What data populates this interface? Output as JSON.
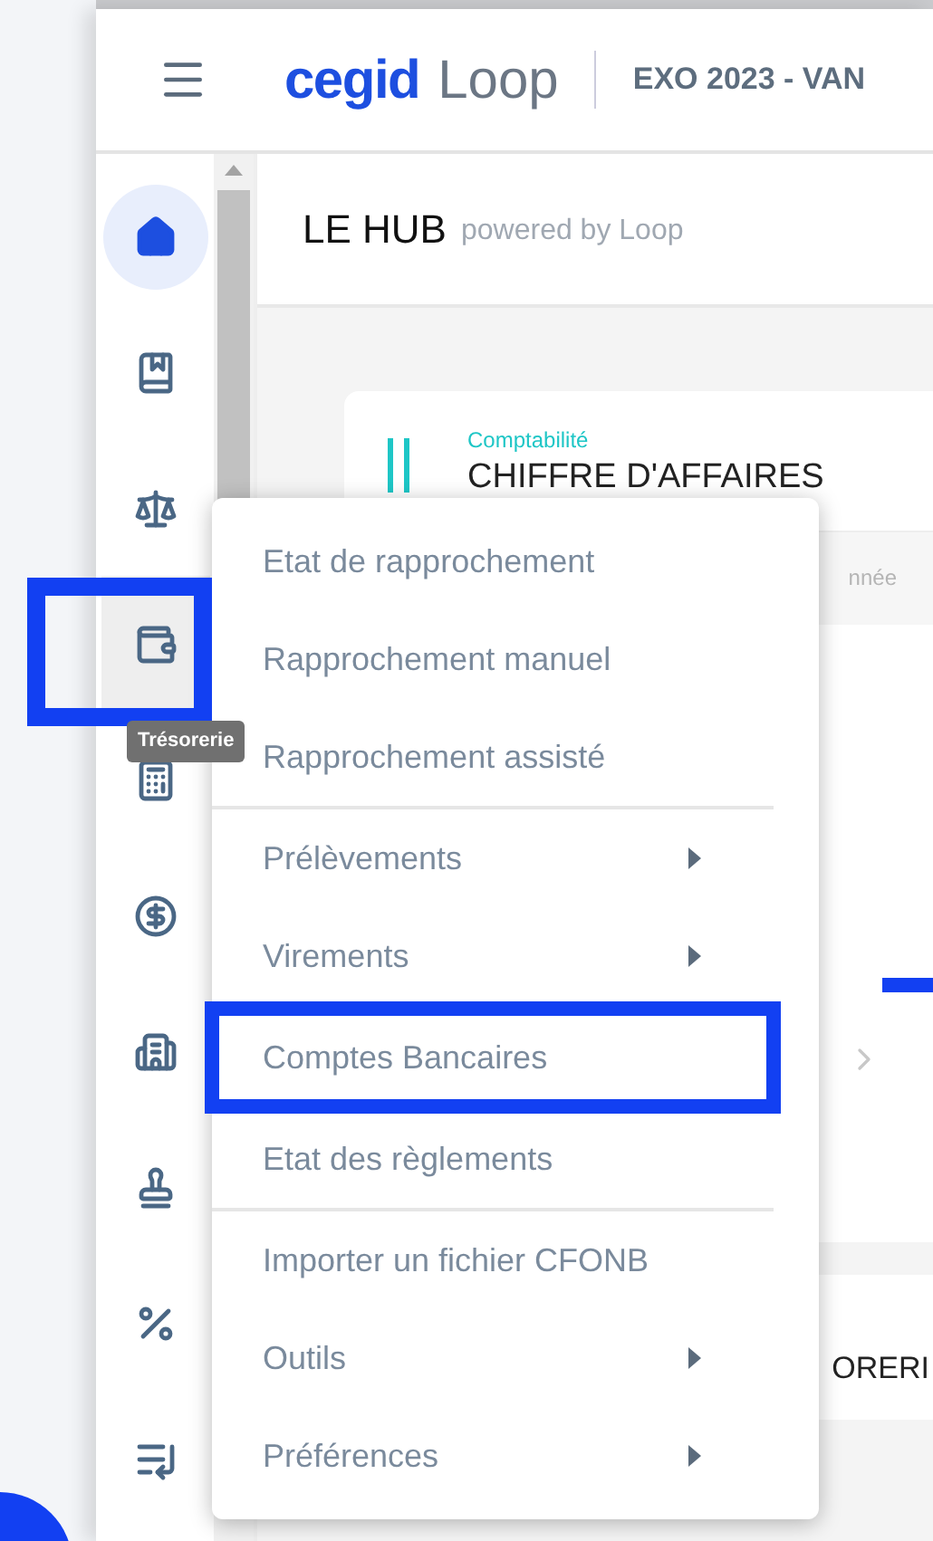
{
  "header": {
    "logo_brand": "cegid",
    "logo_product": "Loop",
    "context": "EXO 2023 - VAN"
  },
  "sidebar": {
    "items": [
      {
        "kind": "home",
        "selected": true,
        "hovered": false
      },
      {
        "kind": "book",
        "selected": false,
        "hovered": false
      },
      {
        "kind": "scale",
        "selected": false,
        "hovered": false
      },
      {
        "kind": "wallet",
        "selected": false,
        "hovered": true
      },
      {
        "kind": "calculator",
        "selected": false,
        "hovered": false
      },
      {
        "kind": "dollar",
        "selected": false,
        "hovered": false
      },
      {
        "kind": "building",
        "selected": false,
        "hovered": false
      },
      {
        "kind": "stamp",
        "selected": false,
        "hovered": false
      },
      {
        "kind": "percent",
        "selected": false,
        "hovered": false
      },
      {
        "kind": "list",
        "selected": false,
        "hovered": false
      }
    ],
    "tooltip": "Trésorerie"
  },
  "page": {
    "title": "LE HUB",
    "subtitle": "powered by Loop",
    "card": {
      "category": "Comptabilité",
      "title": "CHIFFRE D'AFFAIRES",
      "filter": "nnée"
    },
    "bottom_title": "ORERI"
  },
  "menu": {
    "groups": [
      [
        {
          "label": "Etat de rapprochement",
          "has_submenu": false,
          "highlighted": false
        },
        {
          "label": "Rapprochement manuel",
          "has_submenu": false,
          "highlighted": false
        },
        {
          "label": "Rapprochement assisté",
          "has_submenu": false,
          "highlighted": false
        }
      ],
      [
        {
          "label": "Prélèvements",
          "has_submenu": true,
          "highlighted": false
        },
        {
          "label": "Virements",
          "has_submenu": true,
          "highlighted": false
        }
      ],
      [
        {
          "label": "Comptes Bancaires",
          "has_submenu": false,
          "highlighted": true
        }
      ],
      [
        {
          "label": "Etat des règlements",
          "has_submenu": false,
          "highlighted": false
        }
      ],
      [
        {
          "label": "Importer un fichier CFONB",
          "has_submenu": false,
          "highlighted": false
        },
        {
          "label": "Outils",
          "has_submenu": true,
          "highlighted": false
        },
        {
          "label": "Préférences",
          "has_submenu": true,
          "highlighted": false
        }
      ]
    ]
  }
}
